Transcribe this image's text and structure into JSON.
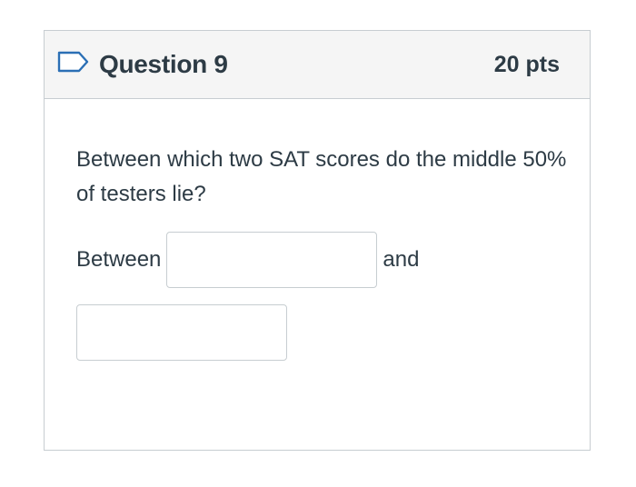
{
  "question": {
    "title": "Question 9",
    "points": "20 pts",
    "text": "Between which two SAT scores do the middle 50% of testers lie?",
    "flag_icon": "flag-outline-icon",
    "answer": {
      "prefix": "Between",
      "conjunction": "and",
      "input1_value": "",
      "input2_value": ""
    }
  },
  "colors": {
    "header_bg": "#f5f5f5",
    "border": "#c7cdd1",
    "text": "#2d3b45",
    "flag_stroke": "#2b6fb5"
  }
}
